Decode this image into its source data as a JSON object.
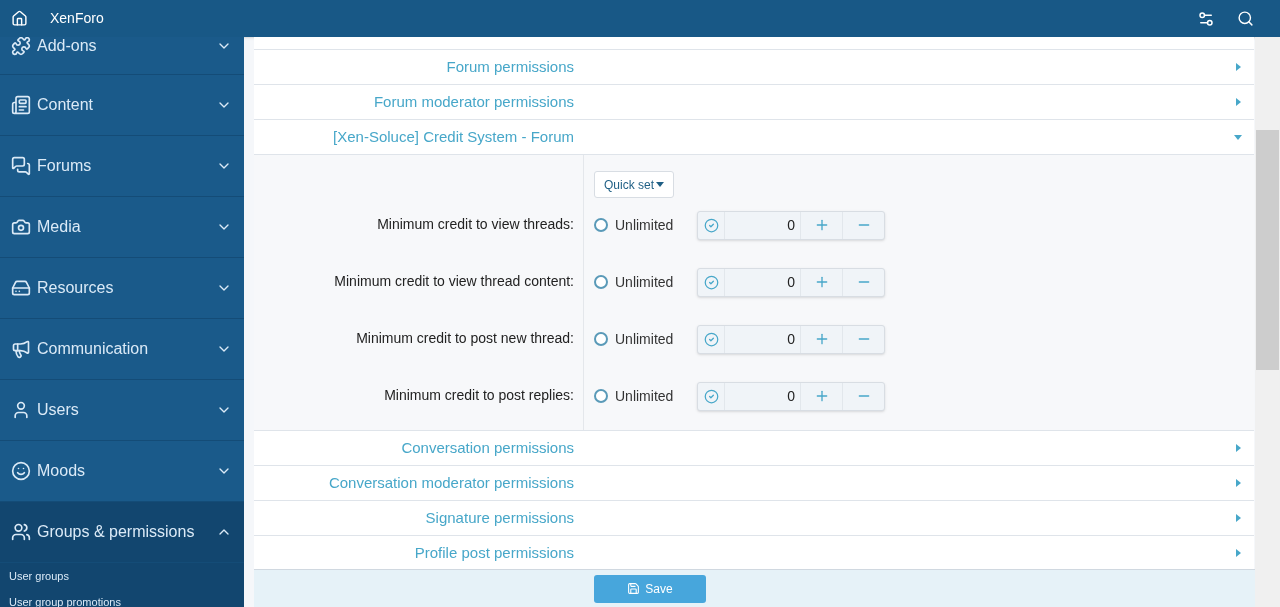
{
  "header": {
    "title": "XenForo"
  },
  "sidebar": {
    "items": [
      {
        "label": "Add-ons",
        "expanded": false
      },
      {
        "label": "Content",
        "expanded": false
      },
      {
        "label": "Forums",
        "expanded": false
      },
      {
        "label": "Media",
        "expanded": false
      },
      {
        "label": "Resources",
        "expanded": false
      },
      {
        "label": "Communication",
        "expanded": false
      },
      {
        "label": "Users",
        "expanded": false
      },
      {
        "label": "Moods",
        "expanded": false
      },
      {
        "label": "Groups & permissions",
        "expanded": true,
        "children": [
          "User groups",
          "User group promotions"
        ]
      }
    ]
  },
  "sections_before": [
    {
      "title": "Forum permissions",
      "expanded": false
    },
    {
      "title": "Forum moderator permissions",
      "expanded": false
    },
    {
      "title": "[Xen-Soluce] Credit System - Forum",
      "expanded": true
    }
  ],
  "quick_set": "Quick set",
  "permissions": [
    {
      "label": "Minimum credit to view threads:",
      "option": "Unlimited",
      "unlimited": false,
      "value": "0"
    },
    {
      "label": "Minimum credit to view thread content:",
      "option": "Unlimited",
      "unlimited": false,
      "value": "0"
    },
    {
      "label": "Minimum credit to post new thread:",
      "option": "Unlimited",
      "unlimited": false,
      "value": "0"
    },
    {
      "label": "Minimum credit to post replies:",
      "option": "Unlimited",
      "unlimited": false,
      "value": "0"
    }
  ],
  "sections_after": [
    {
      "title": "Conversation permissions",
      "expanded": false
    },
    {
      "title": "Conversation moderator permissions",
      "expanded": false
    },
    {
      "title": "Signature permissions",
      "expanded": false
    },
    {
      "title": "Profile post permissions",
      "expanded": false
    }
  ],
  "save_button": "Save"
}
